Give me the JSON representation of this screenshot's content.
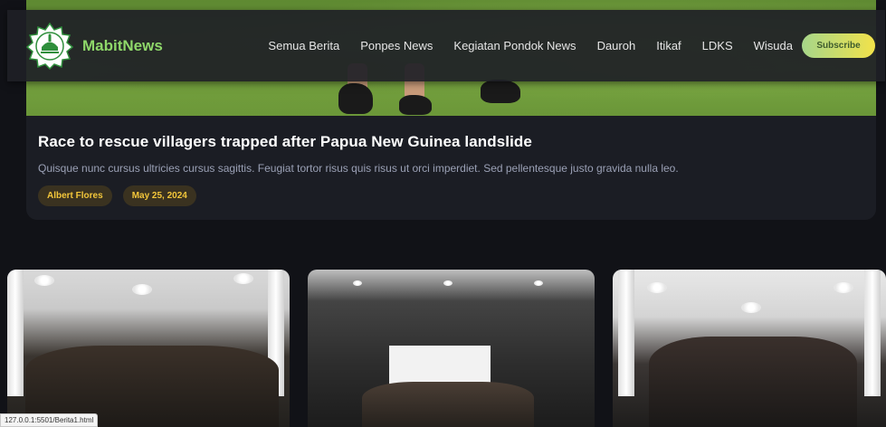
{
  "navbar": {
    "brand": "MabitNews",
    "menu": [
      {
        "label": "Semua Berita",
        "id": "semua-berita"
      },
      {
        "label": "Ponpes News",
        "id": "ponpes-news"
      },
      {
        "label": "Kegiatan Pondok News",
        "id": "kegiatan-pondok-news"
      },
      {
        "label": "Dauroh",
        "id": "dauroh"
      },
      {
        "label": "Itikaf",
        "id": "itikaf"
      },
      {
        "label": "LDKS",
        "id": "ldks"
      },
      {
        "label": "Wisuda",
        "id": "wisuda"
      }
    ],
    "subscribe_label": "Subscribe"
  },
  "featured": {
    "title": "Race to rescue villagers trapped after Papua New Guinea landslide",
    "excerpt": "Quisque nunc cursus ultricies cursus sagittis. Feugiat tortor risus quis risus ut orci imperdiet. Sed pellentesque justo gravida nulla leo.",
    "author": "Albert Flores",
    "date": "May 25, 2024"
  },
  "status_bar": {
    "url": "127.0.0.1:5501/Berita1.html"
  },
  "colors": {
    "background": "#111217",
    "brand_green": "#8fd86a",
    "badge_text": "#f3c63a"
  }
}
